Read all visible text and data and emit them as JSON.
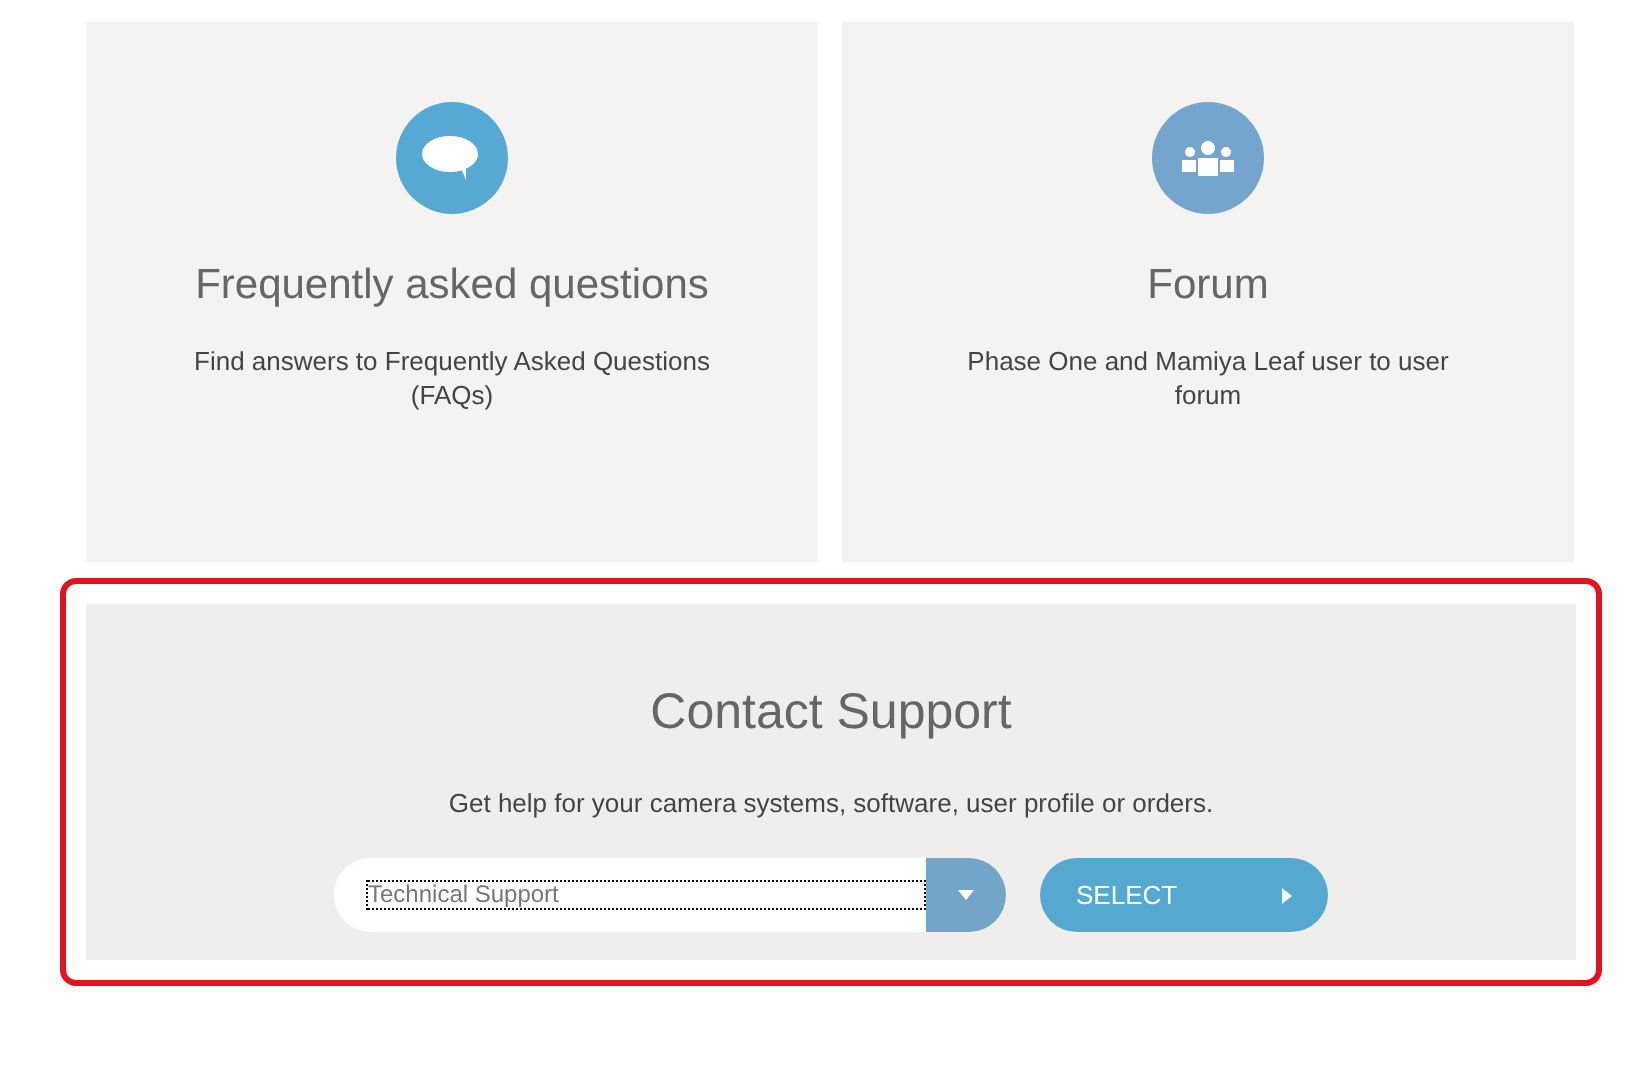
{
  "cards": [
    {
      "kind": "chat",
      "title": "Frequently asked questions",
      "description": "Find answers to Frequently Asked Questions (FAQs)",
      "color": "#55a9d3"
    },
    {
      "kind": "people",
      "title": "Forum",
      "description": "Phase One and Mamiya Leaf user to user forum",
      "color": "#74a6cd"
    }
  ],
  "contact": {
    "title": "Contact Support",
    "description": "Get help for your camera systems, software, user profile or orders.",
    "select_value": "Technical Support",
    "button": "SELECT"
  }
}
